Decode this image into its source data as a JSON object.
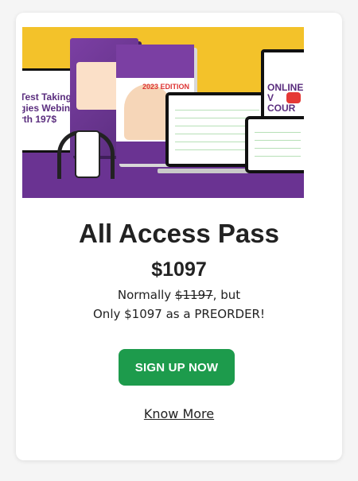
{
  "card": {
    "hero_image": {
      "alt": "All Access Pass products bundle",
      "colors": {
        "top": "#f3c22a",
        "bottom": "#6a3392"
      },
      "laptop_text_1": "Test Taking",
      "laptop_text_2": "gies Webinar",
      "laptop_text_3": "rth 197$",
      "monitor_text_1": "ONLINE V",
      "monitor_text_2": "COUR",
      "book_edition": "2023 EDITION"
    },
    "title": "All Access Pass",
    "price": "$1097",
    "normal_prefix": "Normally ",
    "normal_price": "$1197",
    "normal_suffix": ", but",
    "preorder_text": "Only $1097 as a PREORDER!",
    "cta_label": "SIGN UP NOW",
    "know_more_label": "Know More",
    "accent_color": "#1d9b4c"
  }
}
